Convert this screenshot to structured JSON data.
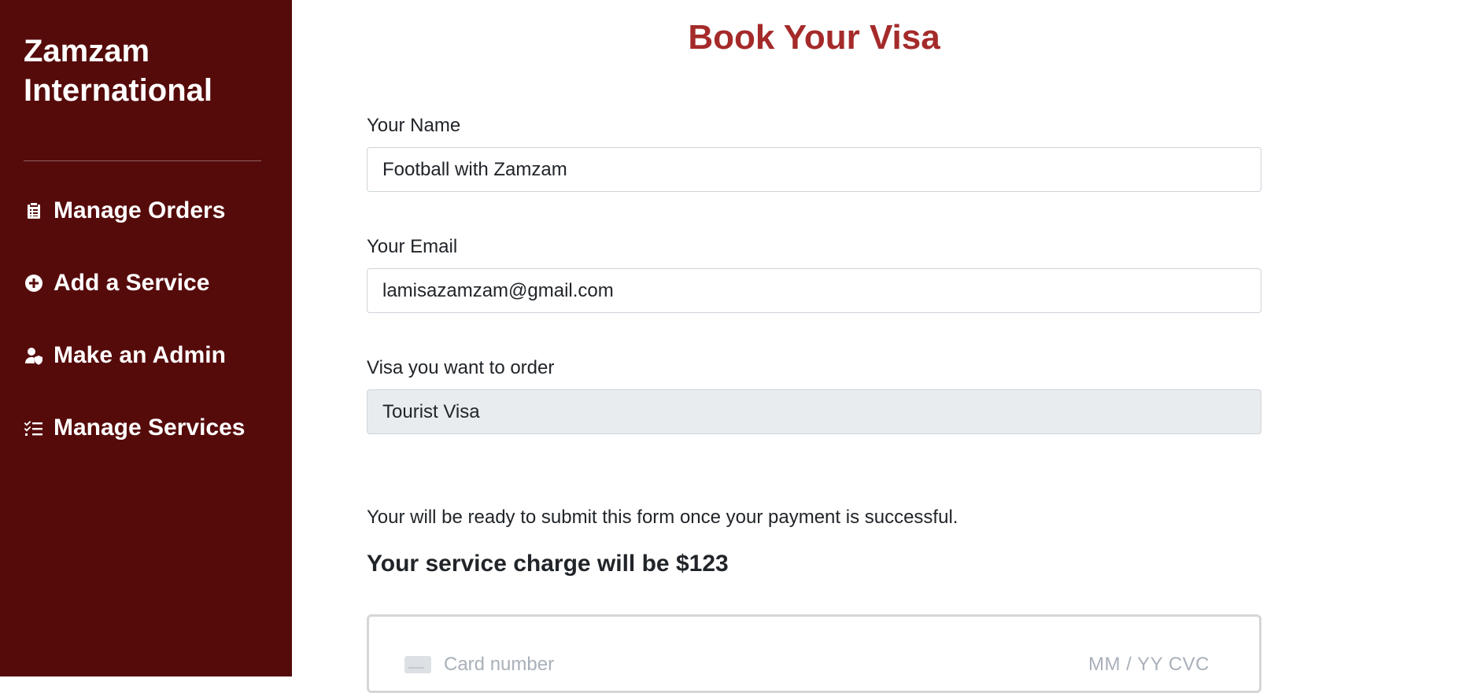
{
  "sidebar": {
    "brand_line1": "Zamzam",
    "brand_line2": "International",
    "items": [
      {
        "label": "Manage Orders",
        "icon": "clipboard-list-icon"
      },
      {
        "label": "Add a Service",
        "icon": "plus-circle-icon"
      },
      {
        "label": "Make an Admin",
        "icon": "user-shield-icon"
      },
      {
        "label": "Manage Services",
        "icon": "tasks-list-icon"
      }
    ],
    "colors": {
      "background": "#560b0b",
      "text": "#ffffff"
    }
  },
  "main": {
    "title": "Book Your Visa",
    "title_color": "#a52a2a",
    "fields": [
      {
        "label": "Your Name",
        "value": "Football with Zamzam"
      },
      {
        "label": "Your Email",
        "value": "lamisazamzam@gmail.com"
      },
      {
        "label": "Visa you want to order",
        "value": "Tourist Visa",
        "readonly": true
      }
    ],
    "note": "Your will be ready to submit this form once your payment is successful.",
    "charge_text": "Your service charge will be $123",
    "card": {
      "icon": "credit-card-icon",
      "number_placeholder": "Card number",
      "expiry_cvc_placeholder": "MM / YY  CVC"
    }
  }
}
